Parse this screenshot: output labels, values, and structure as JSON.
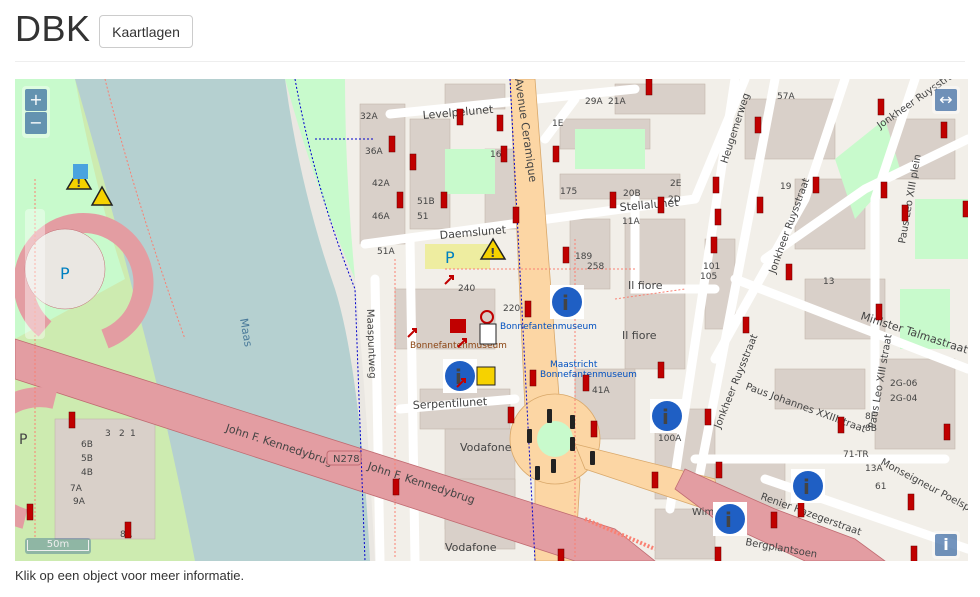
{
  "header": {
    "title": "DBK",
    "button_label": "Kaartlagen"
  },
  "map": {
    "controls": {
      "zoom_in": "+",
      "zoom_out": "−",
      "fullscreen": "↔",
      "info": "i"
    },
    "scale_label": "50m",
    "street_labels": {
      "levelpelunet": "Levelpelunet",
      "daemslunet": "Daemslunet",
      "stellalunet": "Stellalunet",
      "serpentilunet": "Serpentilunet",
      "maaspuntweg": "Maaspuntweg",
      "avenue_ceramique": "Avenue Ceramique",
      "kennedybrug1": "John F. Kennedybrug",
      "kennedybrug2": "John F. Kennedybrug",
      "n278": "N278",
      "heugemerweg": "Heugemerweg",
      "jonkheer1": "Jonkheer Ruysstraat",
      "jonkheer2": "Jonkheer Ruysstraat",
      "jonkheer3": "Jonkheer Ruysstraat",
      "minister": "Minister Talmastraat",
      "paus_johannes": "Paus Johannes XXIIIstraat",
      "paus_leo1": "Paus Leo XIII plein",
      "paus_leo2": "Paus Leo XIII straat",
      "monseigneur": "Monseigneur Poelsplein",
      "maas": "Maas",
      "il_fiore1": "Il fiore",
      "il_fiore2": "Il fiore",
      "vodafone1": "Vodafone",
      "vodafone2": "Vodafone",
      "museum1": "Bonnefantenmuseum",
      "museum2": "Maastricht Bonnefantenmuseum",
      "museum3": "Bonnefantenmuseum",
      "maastricht": "Maastricht",
      "parking": "P",
      "renier": "Renier Hazegerstraat",
      "wim": "Wim",
      "bergplantsoen": "Bergplantsoen"
    },
    "house_numbers": [
      "32A",
      "36A",
      "42A",
      "46A",
      "51A",
      "51B",
      "51",
      "160",
      "175",
      "189",
      "258",
      "2E",
      "20B",
      "2D",
      "1E",
      "11A",
      "240",
      "220",
      "29A",
      "21A",
      "51A",
      "6B",
      "5B",
      "4B",
      "7A",
      "9A",
      "8A",
      "100A",
      "101",
      "105",
      "57A",
      "13",
      "19",
      "71-TR",
      "2G-06",
      "2G-04",
      "8F",
      "8B",
      "13A",
      "61"
    ],
    "poi_icons": [
      "parking-icon",
      "warning-icon",
      "fire-extinguisher-icon",
      "info-icon",
      "hydrant-icon",
      "assembly-point-icon",
      "traffic-light-icon",
      "gate-icon",
      "key-icon"
    ]
  },
  "footer": {
    "text": "Klik op een object voor meer informatie."
  },
  "colors": {
    "water": "#b5d0d0",
    "motorway": "#e39da2",
    "primary": "#fcd6a4",
    "park": "#c8facc",
    "building": "#d9d0c9"
  }
}
